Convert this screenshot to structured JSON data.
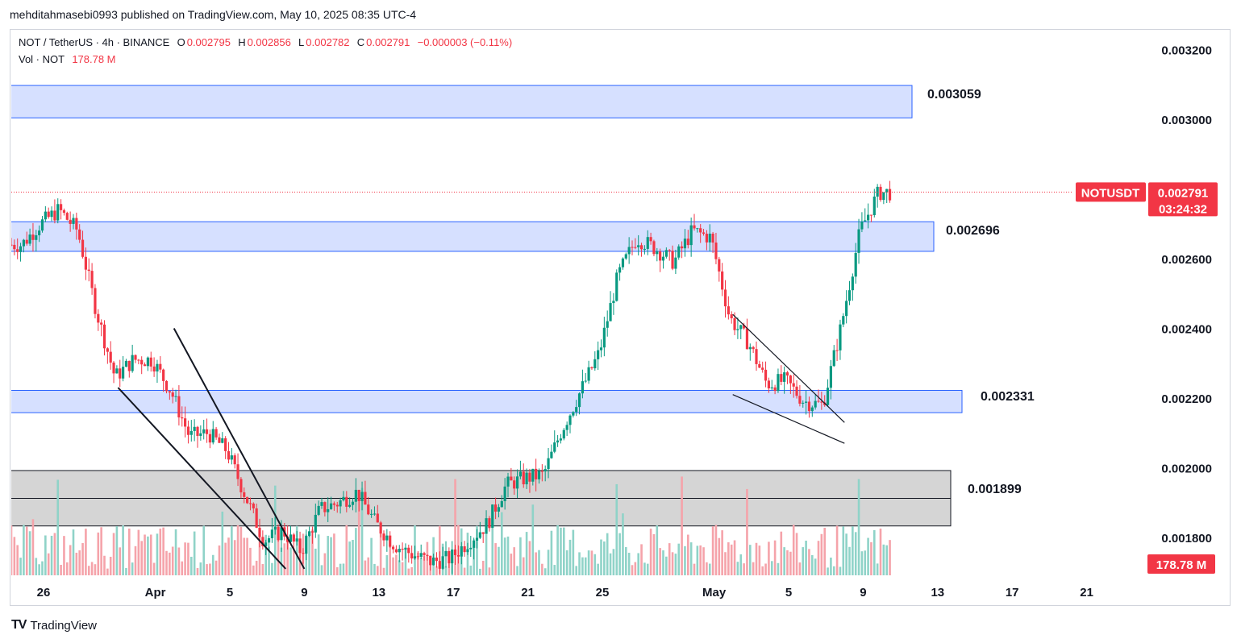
{
  "publisher_line": "mehditahmasebi0993 published on TradingView.com, May 10, 2025 08:35 UTC-4",
  "legend": {
    "symbol": "NOT / TetherUS · 4h · BINANCE",
    "o_label": "O",
    "o_value": "0.002795",
    "h_label": "H",
    "h_value": "0.002856",
    "l_label": "L",
    "l_value": "0.002782",
    "c_label": "C",
    "c_value": "0.002791",
    "change": "−0.000003 (−0.11%)",
    "vol_label": "Vol · NOT",
    "vol_value": "178.78 M"
  },
  "last_price": {
    "ticker": "NOTUSDT",
    "price": "0.002791",
    "countdown": "03:24:32",
    "volume_badge": "178.78 M"
  },
  "footer": {
    "brand": "TradingView",
    "logo": "TV"
  },
  "colors": {
    "up": "#089981",
    "down": "#f23645",
    "zone_fill": "#d6e0ff",
    "zone_stroke": "#2962ff",
    "gray_zone": "#d3d3d3",
    "vol_up": "#8fd3c8",
    "vol_down": "#f5a3aa"
  },
  "chart_data": {
    "type": "candlestick",
    "title": "NOT / TetherUS · 4h · BINANCE",
    "ylim": [
      0.00171,
      0.00328
    ],
    "y_ticks": [
      "0.003200",
      "0.003000",
      "0.002600",
      "0.002400",
      "0.002200",
      "0.002000",
      "0.001800"
    ],
    "x_ticks": [
      "26",
      "Apr",
      "5",
      "9",
      "13",
      "17",
      "21",
      "25",
      "May",
      "5",
      "9",
      "13",
      "17",
      "21"
    ],
    "x_tick_dates": [
      "2025-03-26",
      "2025-04-01",
      "2025-04-05",
      "2025-04-09",
      "2025-04-13",
      "2025-04-17",
      "2025-04-21",
      "2025-04-25",
      "2025-05-01",
      "2025-05-05",
      "2025-05-09",
      "2025-05-13",
      "2025-05-17",
      "2025-05-21"
    ],
    "price_path": [
      [
        "2025-03-25",
        0.00264
      ],
      [
        "2025-03-26",
        0.0027
      ],
      [
        "2025-03-27",
        0.00274
      ],
      [
        "2025-03-28",
        0.00268
      ],
      [
        "2025-03-29",
        0.00245
      ],
      [
        "2025-03-30",
        0.00226
      ],
      [
        "2025-03-31",
        0.00231
      ],
      [
        "2025-04-01",
        0.00231
      ],
      [
        "2025-04-02",
        0.00222
      ],
      [
        "2025-04-03",
        0.00209
      ],
      [
        "2025-04-04",
        0.0021
      ],
      [
        "2025-04-05",
        0.00205
      ],
      [
        "2025-04-06",
        0.00192
      ],
      [
        "2025-04-07",
        0.00179
      ],
      [
        "2025-04-08",
        0.00182
      ],
      [
        "2025-04-09",
        0.00176
      ],
      [
        "2025-04-10",
        0.00188
      ],
      [
        "2025-04-11",
        0.0019
      ],
      [
        "2025-04-12",
        0.00193
      ],
      [
        "2025-04-13",
        0.00184
      ],
      [
        "2025-04-14",
        0.00178
      ],
      [
        "2025-04-15",
        0.00175
      ],
      [
        "2025-04-16",
        0.00173
      ],
      [
        "2025-04-17",
        0.00174
      ],
      [
        "2025-04-18",
        0.00179
      ],
      [
        "2025-04-19",
        0.00184
      ],
      [
        "2025-04-20",
        0.00195
      ],
      [
        "2025-04-21",
        0.00197
      ],
      [
        "2025-04-22",
        0.00198
      ],
      [
        "2025-04-23",
        0.00211
      ],
      [
        "2025-04-24",
        0.00222
      ],
      [
        "2025-04-25",
        0.00233
      ],
      [
        "2025-04-26",
        0.00255
      ],
      [
        "2025-04-27",
        0.00266
      ],
      [
        "2025-04-28",
        0.00263
      ],
      [
        "2025-04-29",
        0.00259
      ],
      [
        "2025-04-30",
        0.00268
      ],
      [
        "2025-05-01",
        0.00266
      ],
      [
        "2025-05-02",
        0.00243
      ],
      [
        "2025-05-03",
        0.00236
      ],
      [
        "2025-05-04",
        0.00224
      ],
      [
        "2025-05-05",
        0.00225
      ],
      [
        "2025-05-06",
        0.00219
      ],
      [
        "2025-05-07",
        0.00218
      ],
      [
        "2025-05-08",
        0.00241
      ],
      [
        "2025-05-09",
        0.00268
      ],
      [
        "2025-05-10",
        0.00279
      ]
    ],
    "zones": [
      {
        "label": "0.003059",
        "from": 0.003004,
        "to": 0.003097,
        "color": "blue"
      },
      {
        "label": "0.002696",
        "from": 0.002621,
        "to": 0.002706,
        "color": "blue"
      },
      {
        "label": "0.002331",
        "from": 0.002158,
        "to": 0.002222,
        "color": "blue"
      },
      {
        "label": "0.001899",
        "from": 0.001833,
        "to": 0.001992,
        "color": "gray",
        "midline": 0.001912
      }
    ],
    "trendlines": [
      {
        "from": [
          "2025-03-30",
          0.00223
        ],
        "to": [
          "2025-04-08",
          0.00171
        ]
      },
      {
        "from": [
          "2025-04-02",
          0.0024
        ],
        "to": [
          "2025-04-09",
          0.00171
        ]
      },
      {
        "from": [
          "2025-05-02",
          0.00244
        ],
        "to": [
          "2025-05-08",
          0.00213
        ]
      },
      {
        "from": [
          "2025-05-02",
          0.00221
        ],
        "to": [
          "2025-05-08",
          0.00207
        ]
      }
    ],
    "last_close": 0.002791,
    "last_volume": "178.78 M"
  }
}
